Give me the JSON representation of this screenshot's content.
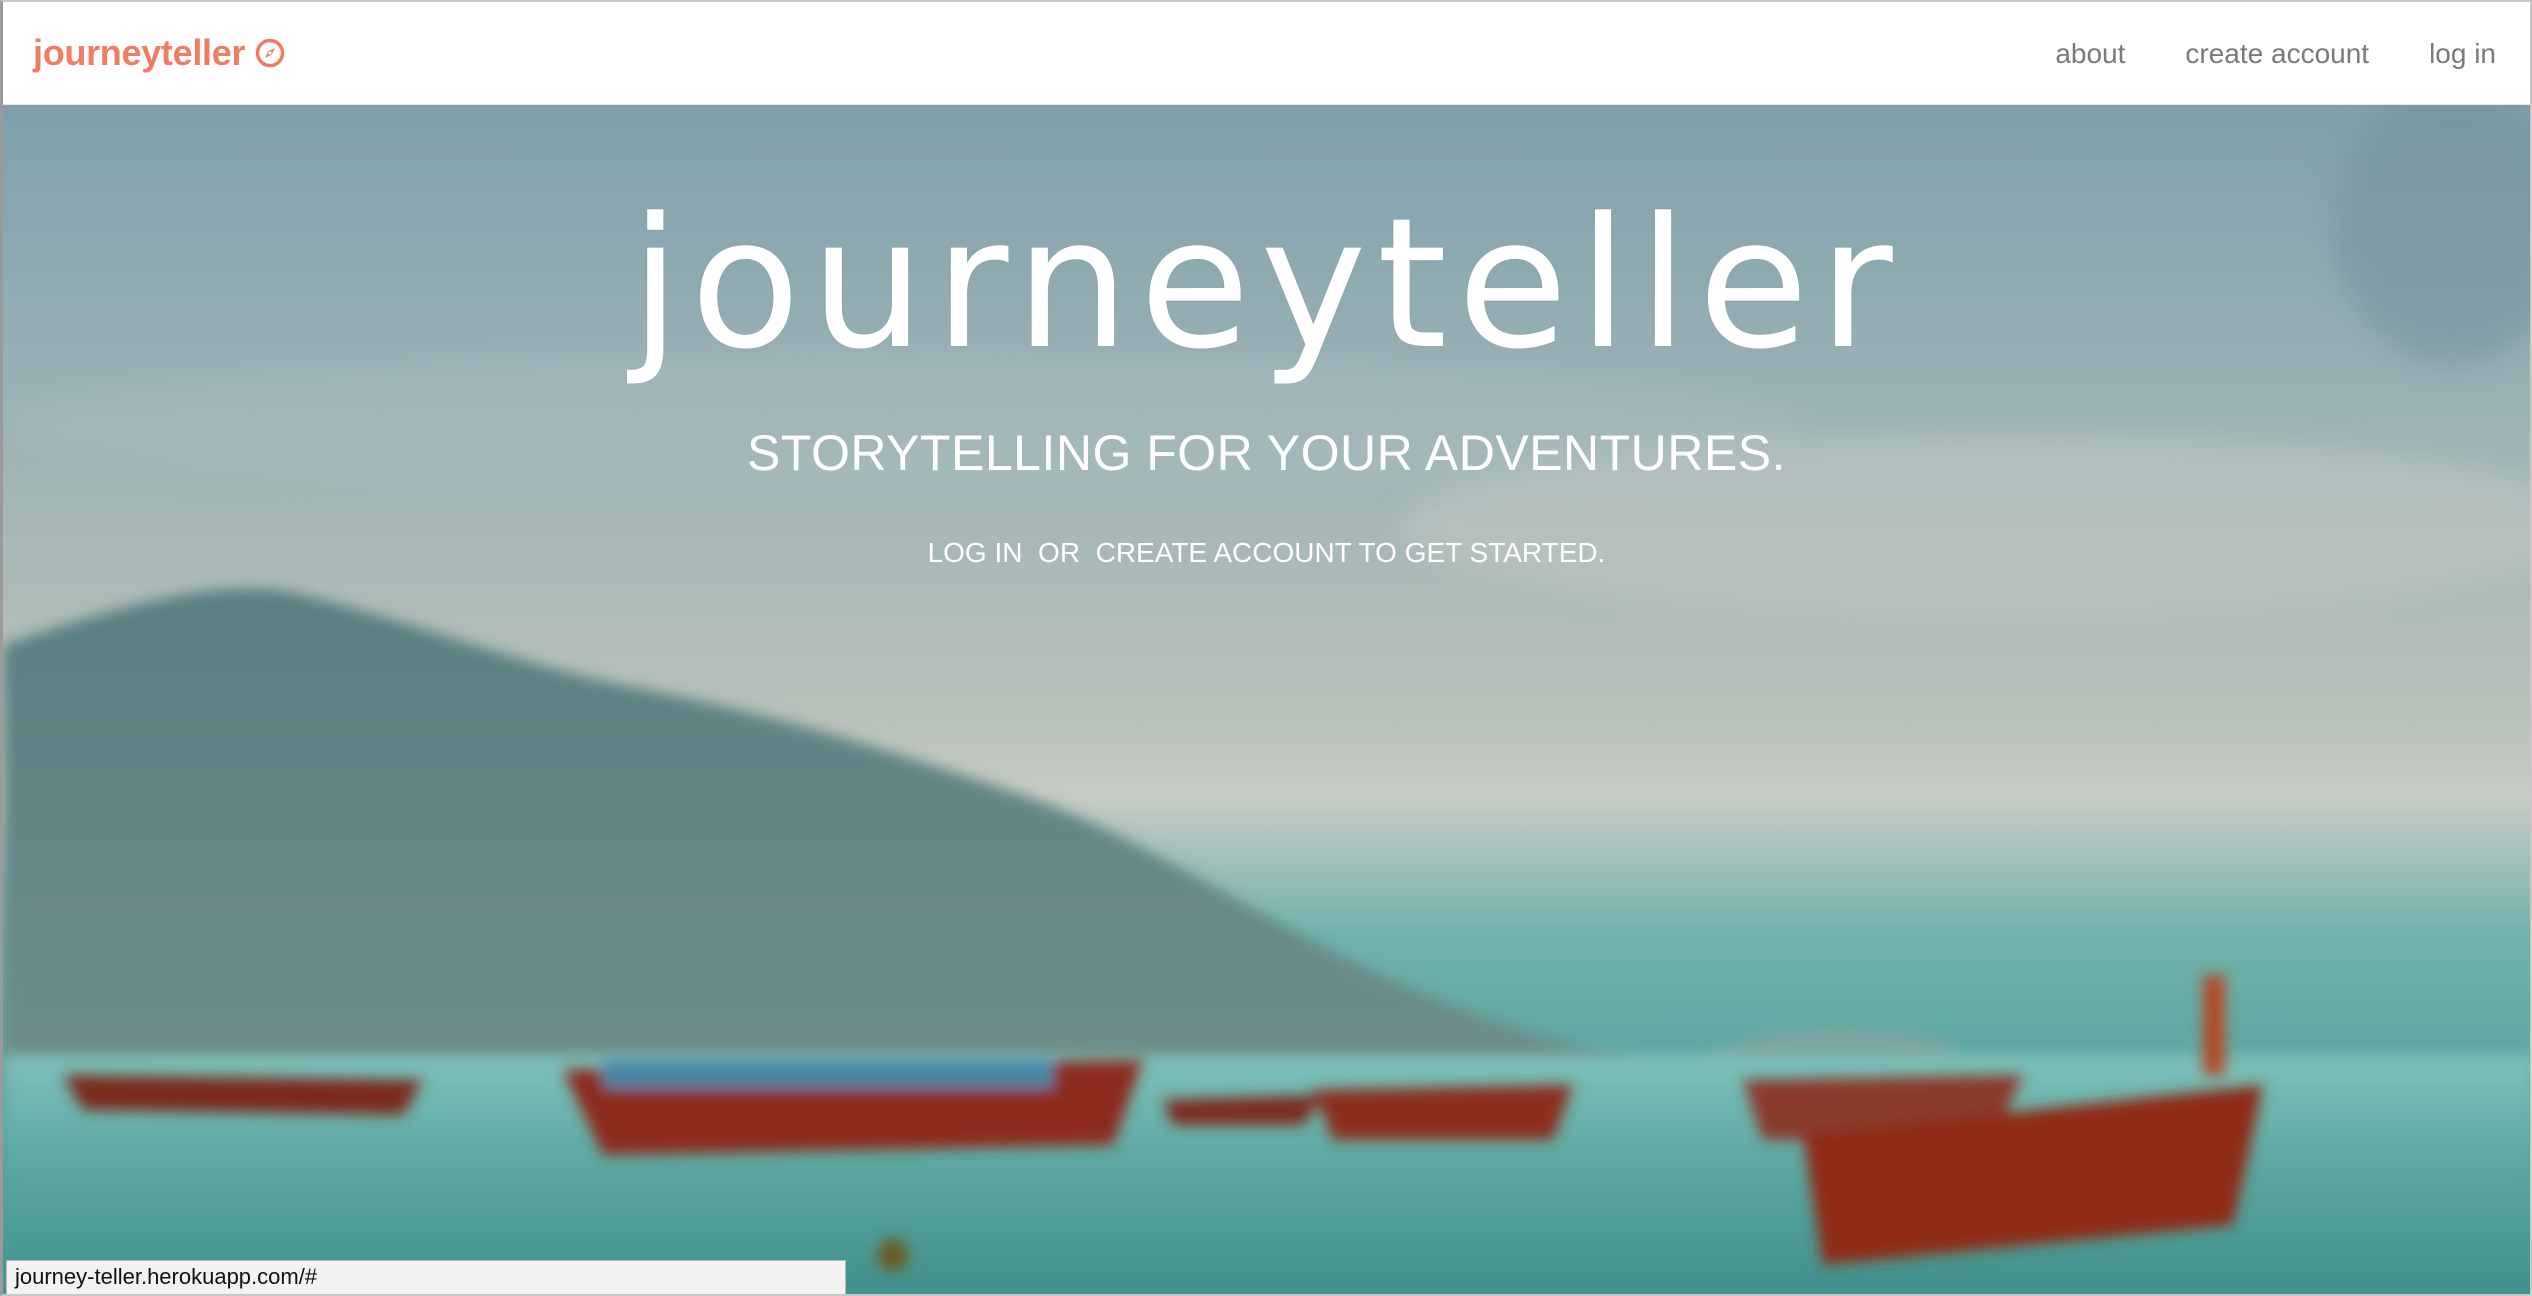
{
  "navbar": {
    "brand": "journeyteller",
    "brand_icon": "compass-icon",
    "links": [
      {
        "label": "about"
      },
      {
        "label": "create account"
      },
      {
        "label": "log in"
      }
    ]
  },
  "hero": {
    "title": "journeyteller",
    "tagline": "STORYTELLING FOR YOUR ADVENTURES.",
    "cta": {
      "login": "LOG IN",
      "or": "  OR  ",
      "create": "CREATE ACCOUNT",
      "suffix": " TO GET STARTED."
    }
  },
  "status_bar": {
    "url": "journey-teller.herokuapp.com/#"
  },
  "colors": {
    "brand": "#ef7d64",
    "nav_text": "#7a7a7a",
    "hero_text": "#ffffff"
  }
}
